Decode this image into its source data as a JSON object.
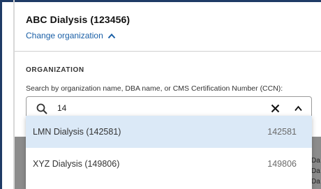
{
  "header": {
    "org_name": "ABC Dialysis (123456)",
    "change_org_label": "Change organization"
  },
  "section": {
    "label": "ORGANIZATION",
    "helper": "Search by organization name, DBA name, or CMS Certification Number (CCN):"
  },
  "search": {
    "value": "14"
  },
  "results": [
    {
      "name": "LMN Dialysis (142581)",
      "code": "142581",
      "highlighted": true
    },
    {
      "name": "XYZ Dialysis (149806)",
      "code": "149806",
      "highlighted": false
    }
  ],
  "background_fragments": [
    "Da",
    "Da",
    "Da"
  ],
  "colors": {
    "link": "#1a5fa6",
    "highlight": "#dbe9f7",
    "frame": "#1f3b66",
    "overlay": "#8c8c8c"
  }
}
